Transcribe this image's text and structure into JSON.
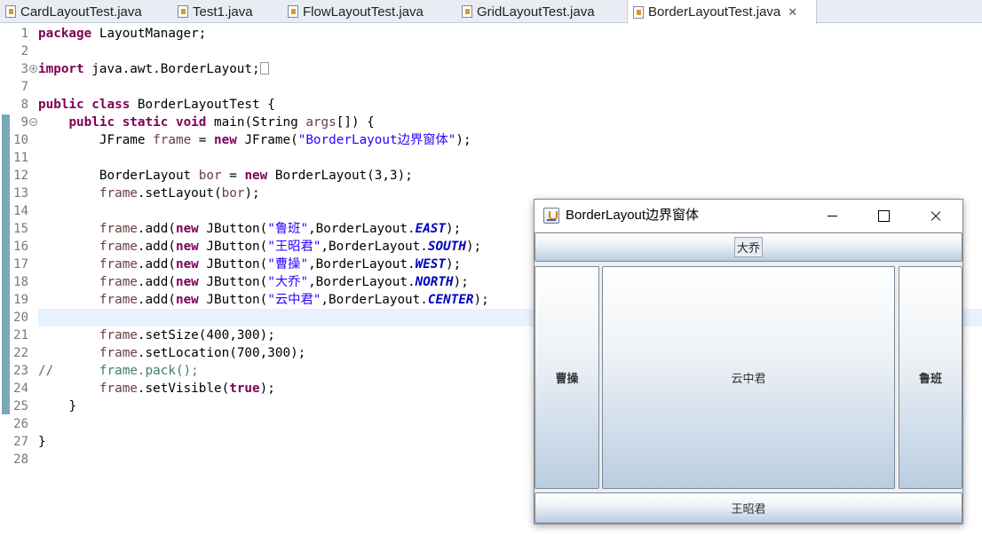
{
  "tabs": [
    {
      "label": "CardLayoutTest.java",
      "active": false
    },
    {
      "label": "Test1.java",
      "active": false
    },
    {
      "label": "FlowLayoutTest.java",
      "active": false
    },
    {
      "label": "GridLayoutTest.java",
      "active": false
    },
    {
      "label": "BorderLayoutTest.java",
      "active": true
    }
  ],
  "tab_close_glyph": "✕",
  "editor": {
    "line_numbers": [
      "1",
      "2",
      "3",
      "7",
      "8",
      "9",
      "10",
      "11",
      "12",
      "13",
      "14",
      "15",
      "16",
      "17",
      "18",
      "19",
      "20",
      "21",
      "22",
      "23",
      "24",
      "25",
      "26",
      "27",
      "28"
    ],
    "code": {
      "l1": {
        "kw": "package",
        "rest": " LayoutManager;"
      },
      "l3": {
        "kw": "import",
        "rest": " java.awt.BorderLayout;"
      },
      "l8": {
        "kw1": "public",
        "kw2": "class",
        "rest": " BorderLayoutTest {"
      },
      "l9": {
        "kw1": "public",
        "kw2": "static",
        "kw3": "void",
        "rest": " main(String ",
        "var": "args",
        "rest2": "[]) {"
      },
      "l10": {
        "a": "JFrame ",
        "var": "frame",
        "b": " = ",
        "kw": "new",
        "c": " JFrame(",
        "str": "\"BorderLayout边界窗体\"",
        "d": ");"
      },
      "l12": {
        "a": "BorderLayout ",
        "var": "bor",
        "b": " = ",
        "kw": "new",
        "c": " BorderLayout(3,3);"
      },
      "l13": {
        "var": "frame",
        "a": ".setLayout(",
        "var2": "bor",
        "b": ");"
      },
      "l15": {
        "str": "\"鲁班\"",
        "fld": "EAST"
      },
      "l16": {
        "str": "\"王昭君\"",
        "fld": "SOUTH"
      },
      "l17": {
        "str": "\"曹操\"",
        "fld": "WEST"
      },
      "l18": {
        "str": "\"大乔\"",
        "fld": "NORTH"
      },
      "l19": {
        "str": "\"云中君\"",
        "fld": "CENTER"
      },
      "l21": {
        "a": ".setSize(400,300);"
      },
      "l22": {
        "a": ".setLocation(700,300);"
      },
      "l23": {
        "cm1": "//",
        "cm2": "frame.pack();"
      },
      "l24": {
        "a": ".setVisible(",
        "kw": "true",
        "b": ");"
      },
      "l25": {
        "a": "}"
      },
      "l27": {
        "a": "}"
      }
    },
    "add_prefix": ".add(",
    "add_new": "new",
    "add_jbutton": " JButton(",
    "add_border": ",BorderLayout.",
    "add_suffix": ");",
    "frame_var": "frame"
  },
  "jframe": {
    "title": "BorderLayout边界窗体",
    "buttons": {
      "north": "大乔",
      "west": "曹操",
      "center": "云中君",
      "east": "鲁班",
      "south": "王昭君"
    }
  }
}
